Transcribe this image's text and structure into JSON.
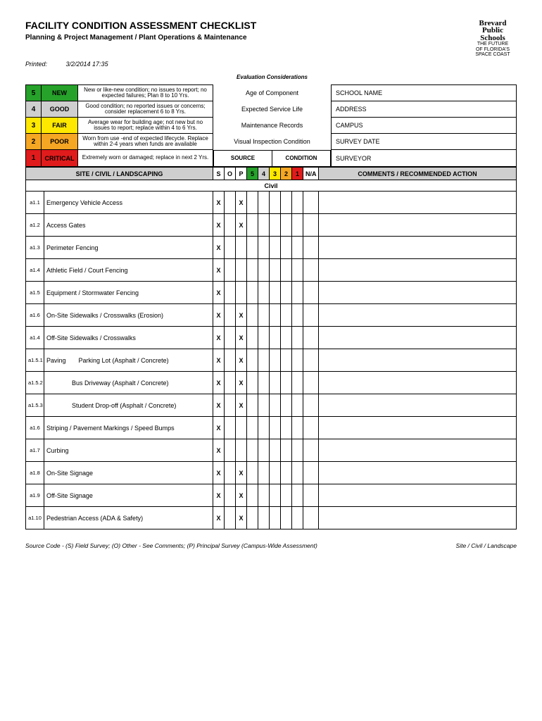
{
  "title": "FACILITY CONDITION ASSESSMENT CHECKLIST",
  "subtitle": "Planning & Project Management / Plant Operations & Maintenance",
  "printed_label": "Printed:",
  "printed_value": "3/2/2014 17:35",
  "logo": {
    "l1": "Brevard",
    "l2": "Public",
    "l3": "Schools",
    "l4": "THE FUTURE",
    "l5": "OF FLORIDA'S",
    "l6": "SPACE COAST"
  },
  "legend": [
    {
      "num": "5",
      "tag": "NEW",
      "desc": "New or like-new condition; no issues to report; no expected failures; Plan 8 to 10 Yrs."
    },
    {
      "num": "4",
      "tag": "GOOD",
      "desc": "Good condition; no reported issues or concerns; consider replacement 6 to 8 Yrs."
    },
    {
      "num": "3",
      "tag": "FAIR",
      "desc": "Average wear for building age; not new but no issues to report; replace within 4 to 6 Yrs."
    },
    {
      "num": "2",
      "tag": "POOR",
      "desc": "Worn from use -end of expected lifecycle. Replace within 2-4 years when funds are available"
    },
    {
      "num": "1",
      "tag": "CRITICAL",
      "desc": "Extremely worn or damaged; replace in next 2 Yrs."
    }
  ],
  "considerations_title": "Evaluation Considerations",
  "considerations": [
    "Age of Component",
    "Expected Service Life",
    "Maintenance Records",
    "Visual Inspection Condition"
  ],
  "info_labels": [
    "SCHOOL NAME",
    "ADDRESS",
    "CAMPUS",
    "SURVEY DATE",
    "SURVEYOR"
  ],
  "h2": {
    "source": "SOURCE",
    "condition": "CONDITION",
    "section": "SITE / CIVIL / LANDSCAPING",
    "s": "S",
    "o": "O",
    "p": "P",
    "n5": "5",
    "n4": "4",
    "n3": "3",
    "n2": "2",
    "n1": "1",
    "na": "N/A",
    "comments": "COMMENTS / RECOMMENDED ACTION"
  },
  "category": "Civil",
  "rows": [
    {
      "id": "a1.1",
      "name": "Emergency Vehicle Access",
      "s": "X",
      "o": "",
      "p": "X"
    },
    {
      "id": "a1.2",
      "name": "Access Gates",
      "s": "X",
      "o": "",
      "p": "X"
    },
    {
      "id": "a1.3",
      "name": "Perimeter Fencing",
      "s": "X",
      "o": "",
      "p": ""
    },
    {
      "id": "a1.4",
      "name": "Athletic Field / Court Fencing",
      "s": "X",
      "o": "",
      "p": ""
    },
    {
      "id": "a1.5",
      "name": "Equipment / Stormwater Fencing",
      "s": "X",
      "o": "",
      "p": ""
    },
    {
      "id": "a1.6",
      "name": "On-Site Sidewalks / Crosswalks (Erosion)",
      "s": "X",
      "o": "",
      "p": "X"
    },
    {
      "id": "a1.4",
      "name": "Off-Site Sidewalks / Crosswalks",
      "s": "X",
      "o": "",
      "p": "X"
    },
    {
      "id": "a1.5.1",
      "name": "Paving  Parking Lot (Asphalt / Concrete)",
      "s": "X",
      "o": "",
      "p": "X"
    },
    {
      "id": "a1.5.2",
      "name": "    Bus Driveway (Asphalt / Concrete)",
      "s": "X",
      "o": "",
      "p": "X"
    },
    {
      "id": "a1.5.3",
      "name": "    Student Drop-off (Asphalt / Concrete)",
      "s": "X",
      "o": "",
      "p": "X"
    },
    {
      "id": "a1.6",
      "name": "Striping / Pavement Markings / Speed Bumps",
      "s": "X",
      "o": "",
      "p": ""
    },
    {
      "id": "a1.7",
      "name": "Curbing",
      "s": "X",
      "o": "",
      "p": ""
    },
    {
      "id": "a1.8",
      "name": "On-Site Signage",
      "s": "X",
      "o": "",
      "p": "X"
    },
    {
      "id": "a1.9",
      "name": "Off-Site Signage",
      "s": "X",
      "o": "",
      "p": "X"
    },
    {
      "id": "a1.10",
      "name": "Pedestrian Access (ADA & Safety)",
      "s": "X",
      "o": "",
      "p": "X"
    }
  ],
  "footer_left": "Source Code - (S) Field Survey; (O) Other - See Comments; (P) Principal Survey (Campus-Wide Assessment)",
  "footer_right": "Site / Civil / Landscape"
}
